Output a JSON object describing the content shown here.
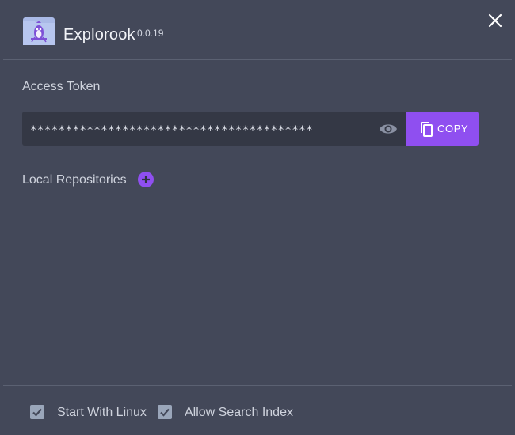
{
  "app": {
    "title": "Explorook",
    "version": "0.0.19"
  },
  "icons": {
    "close": "close-icon",
    "visibility": "eye-icon",
    "copy": "copy-icon",
    "add": "add-circle-icon",
    "check": "checkmark-icon"
  },
  "access_token": {
    "label": "Access Token",
    "masked_value": "****************************************",
    "copy_label": "COPY"
  },
  "repositories": {
    "label": "Local Repositories"
  },
  "footer": {
    "start_with_linux": {
      "label": "Start With Linux",
      "checked": true
    },
    "allow_search_index": {
      "label": "Allow Search Index",
      "checked": true
    }
  },
  "colors": {
    "background": "#434859",
    "field": "#343845",
    "accent": "#8f4ff0",
    "checkbox": "#9aa6ba"
  }
}
